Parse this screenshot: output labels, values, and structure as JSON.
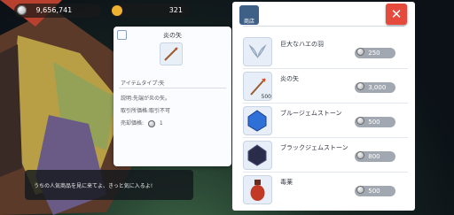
{
  "hud": {
    "zeny": "9,656,741",
    "cash": "321"
  },
  "tooltip": {
    "title": "炎の矢",
    "item_type": "アイテムタイプ:矢",
    "description": "説明:先端が炎の矢。",
    "trade_price": "取引所価格:取引不可",
    "sell_label": "売却価格:",
    "sell_value": "1"
  },
  "shop": {
    "header_label": "商店",
    "items": [
      {
        "name": "巨大なハエの羽",
        "price": "250"
      },
      {
        "name": "炎の矢",
        "price": "3,000",
        "badge": "500"
      },
      {
        "name": "ブルージェムストーン",
        "price": "500"
      },
      {
        "name": "ブラックジェムストーン",
        "price": "800"
      },
      {
        "name": "毒薬",
        "price": "500"
      }
    ]
  },
  "npc_dialog": "うちの人気商品を見に来てよ、きっと気に入るよ!",
  "colors": {
    "close_button": "#e64a3c",
    "price_pill": "#a2a8b1"
  }
}
